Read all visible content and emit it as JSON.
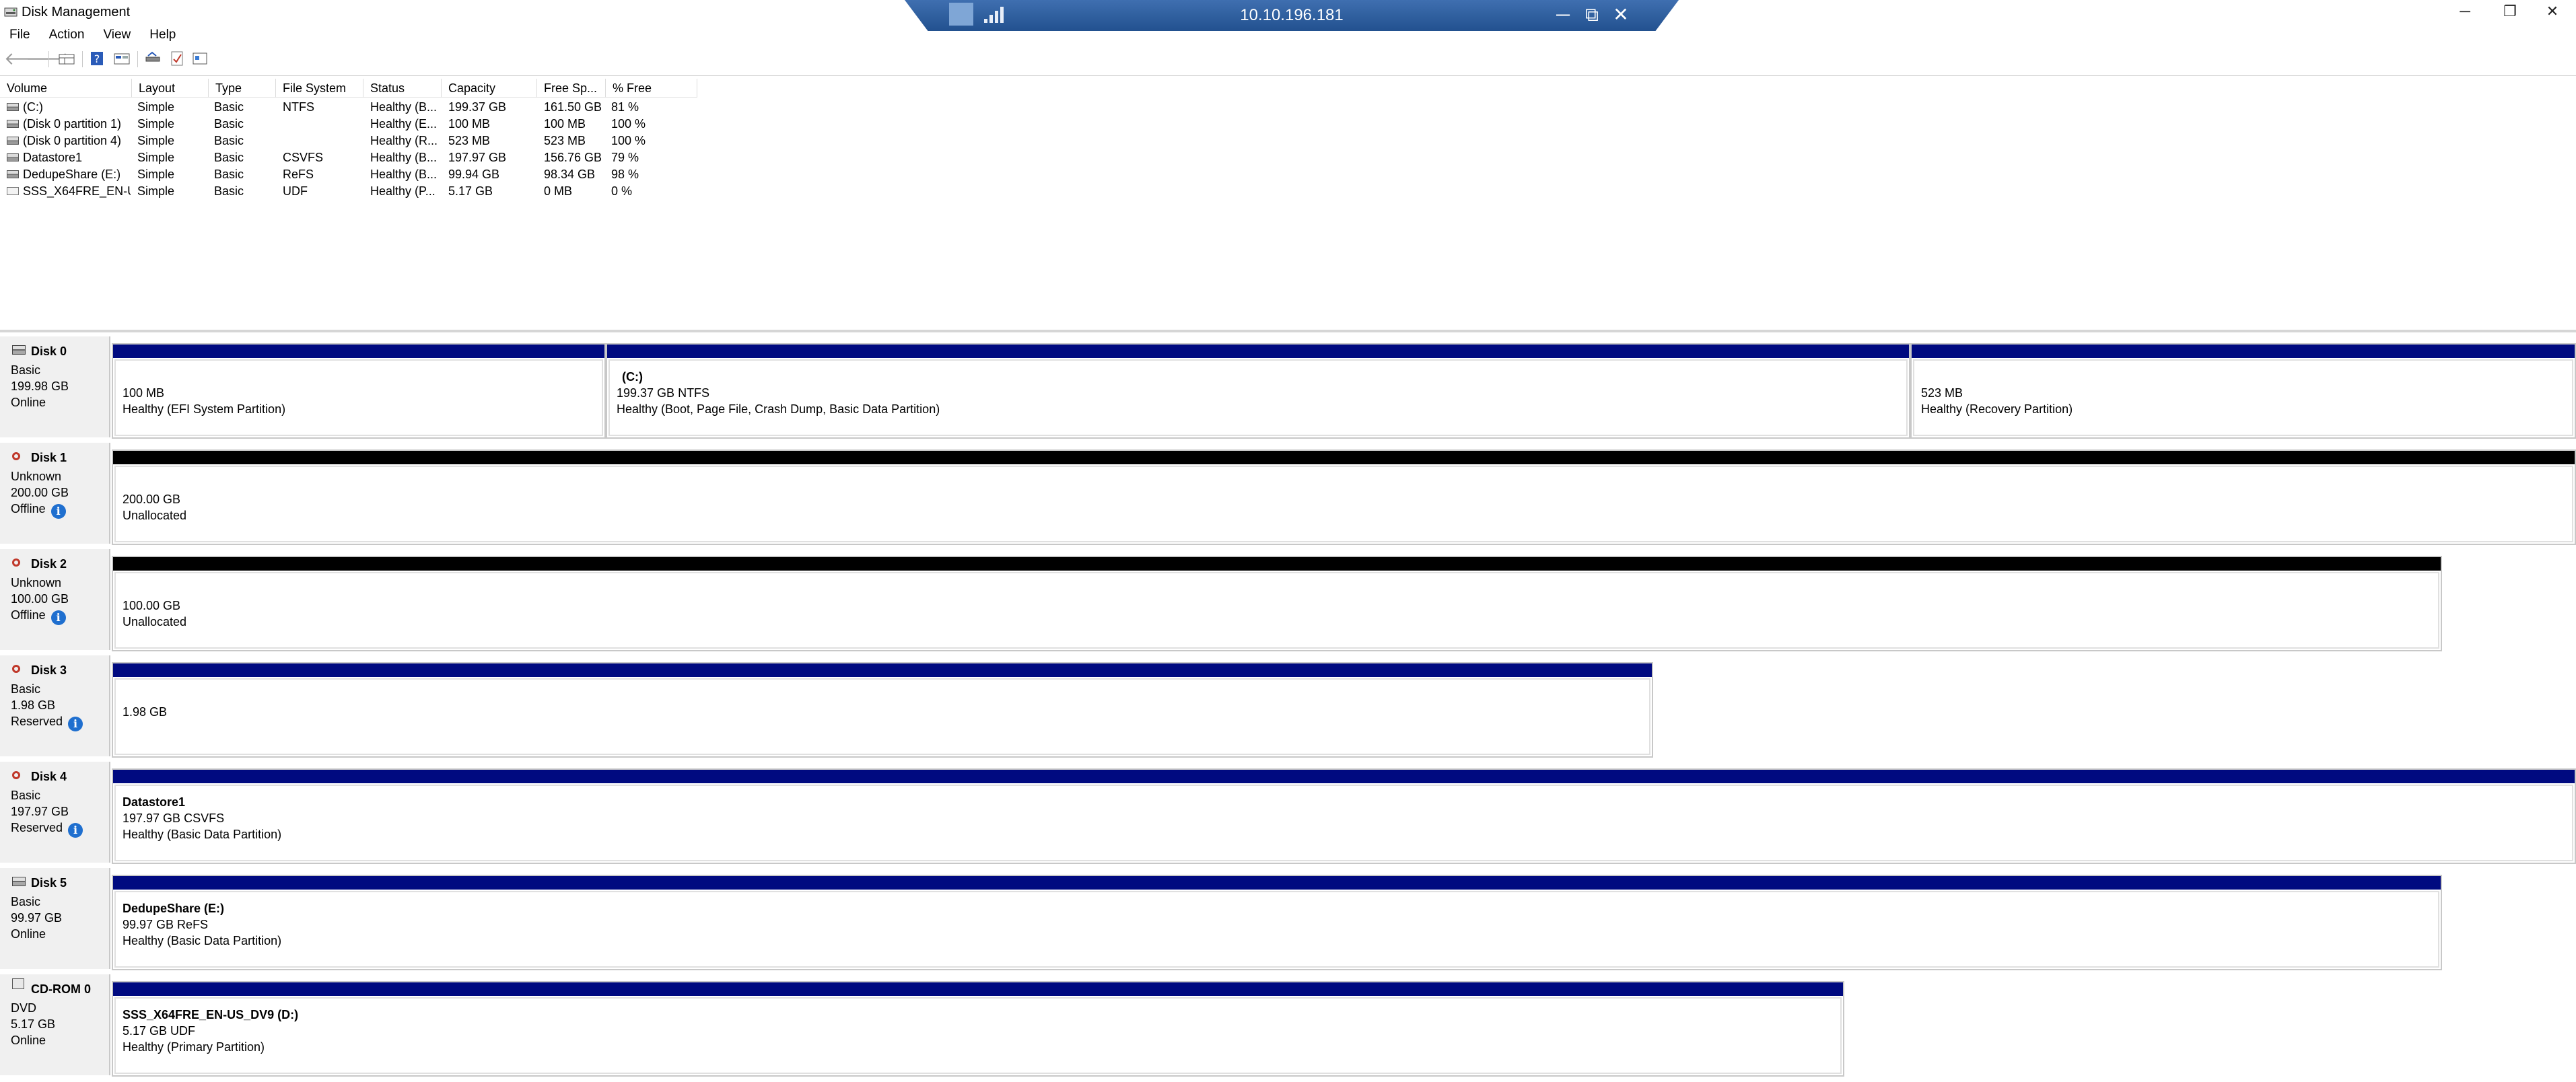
{
  "window": {
    "title": "Disk Management",
    "minimize": "─",
    "restore": "❐",
    "close": "✕"
  },
  "remote_bar": {
    "host": "10.10.196.181",
    "minimize": "─",
    "restore": "⧉",
    "close": "✕"
  },
  "menu": [
    {
      "label": "File"
    },
    {
      "label": "Action"
    },
    {
      "label": "View"
    },
    {
      "label": "Help"
    }
  ],
  "toolbar": [
    "back-icon",
    "forward-icon",
    "disk-list-icon",
    "help-icon",
    "properties-icon",
    "rescan-icon",
    "checklist-icon",
    "settings-icon"
  ],
  "volume_list": {
    "columns": [
      "Volume",
      "Layout",
      "Type",
      "File System",
      "Status",
      "Capacity",
      "Free Sp...",
      "% Free"
    ],
    "rows": [
      {
        "volume": "(C:)",
        "layout": "Simple",
        "type": "Basic",
        "fs": "NTFS",
        "status": "Healthy (B...",
        "capacity": "199.37 GB",
        "free": "161.50 GB",
        "pct": "81 %",
        "icon": "drive"
      },
      {
        "volume": "(Disk 0 partition 1)",
        "layout": "Simple",
        "type": "Basic",
        "fs": "",
        "status": "Healthy (E...",
        "capacity": "100 MB",
        "free": "100 MB",
        "pct": "100 %",
        "icon": "drive"
      },
      {
        "volume": "(Disk 0 partition 4)",
        "layout": "Simple",
        "type": "Basic",
        "fs": "",
        "status": "Healthy (R...",
        "capacity": "523 MB",
        "free": "523 MB",
        "pct": "100 %",
        "icon": "drive"
      },
      {
        "volume": "Datastore1",
        "layout": "Simple",
        "type": "Basic",
        "fs": "CSVFS",
        "status": "Healthy (B...",
        "capacity": "197.97 GB",
        "free": "156.76 GB",
        "pct": "79 %",
        "icon": "drive"
      },
      {
        "volume": "DedupeShare (E:)",
        "layout": "Simple",
        "type": "Basic",
        "fs": "ReFS",
        "status": "Healthy (B...",
        "capacity": "99.94 GB",
        "free": "98.34 GB",
        "pct": "98 %",
        "icon": "drive"
      },
      {
        "volume": "SSS_X64FRE_EN-U...",
        "layout": "Simple",
        "type": "Basic",
        "fs": "UDF",
        "status": "Healthy (P...",
        "capacity": "5.17 GB",
        "free": "0 MB",
        "pct": "0 %",
        "icon": "disc"
      }
    ]
  },
  "disks": [
    {
      "name": "Disk 0",
      "type": "Basic",
      "size": "199.98 GB",
      "state": "Online",
      "info": false,
      "icon": "drive",
      "partitions": [
        {
          "title": "",
          "size": "100 MB",
          "status": "Healthy (EFI System Partition)",
          "bar": "blue"
        },
        {
          "title": "(C:)",
          "size": "199.37 GB NTFS",
          "status": "Healthy (Boot, Page File, Crash Dump, Basic Data Partition)",
          "bar": "blue"
        },
        {
          "title": "",
          "size": "523 MB",
          "status": "Healthy (Recovery Partition)",
          "bar": "blue"
        }
      ]
    },
    {
      "name": "Disk 1",
      "type": "Unknown",
      "size": "200.00 GB",
      "state": "Offline",
      "info": true,
      "icon": "offline",
      "partitions": [
        {
          "title": "",
          "size": "200.00 GB",
          "status": "Unallocated",
          "bar": "black"
        }
      ]
    },
    {
      "name": "Disk 2",
      "type": "Unknown",
      "size": "100.00 GB",
      "state": "Offline",
      "info": true,
      "icon": "offline",
      "partitions": [
        {
          "title": "",
          "size": "100.00 GB",
          "status": "Unallocated",
          "bar": "black"
        }
      ]
    },
    {
      "name": "Disk 3",
      "type": "Basic",
      "size": "1.98 GB",
      "state": "Reserved",
      "info": true,
      "icon": "offline",
      "partitions": [
        {
          "title": "",
          "size": "1.98 GB",
          "status": "",
          "bar": "blue"
        }
      ]
    },
    {
      "name": "Disk 4",
      "type": "Basic",
      "size": "197.97 GB",
      "state": "Reserved",
      "info": true,
      "icon": "offline",
      "partitions": [
        {
          "title": "Datastore1",
          "size": "197.97 GB CSVFS",
          "status": "Healthy (Basic Data Partition)",
          "bar": "blue"
        }
      ]
    },
    {
      "name": "Disk 5",
      "type": "Basic",
      "size": "99.97 GB",
      "state": "Online",
      "info": false,
      "icon": "drive",
      "partitions": [
        {
          "title": "DedupeShare  (E:)",
          "size": "99.97 GB ReFS",
          "status": "Healthy (Basic Data Partition)",
          "bar": "blue"
        }
      ]
    },
    {
      "name": "CD-ROM 0",
      "type": "DVD",
      "size": "5.17 GB",
      "state": "Online",
      "info": false,
      "icon": "cdrom",
      "partitions": [
        {
          "title": "SSS_X64FRE_EN-US_DV9  (D:)",
          "size": "5.17 GB UDF",
          "status": "Healthy (Primary Partition)",
          "bar": "blue"
        }
      ]
    }
  ]
}
